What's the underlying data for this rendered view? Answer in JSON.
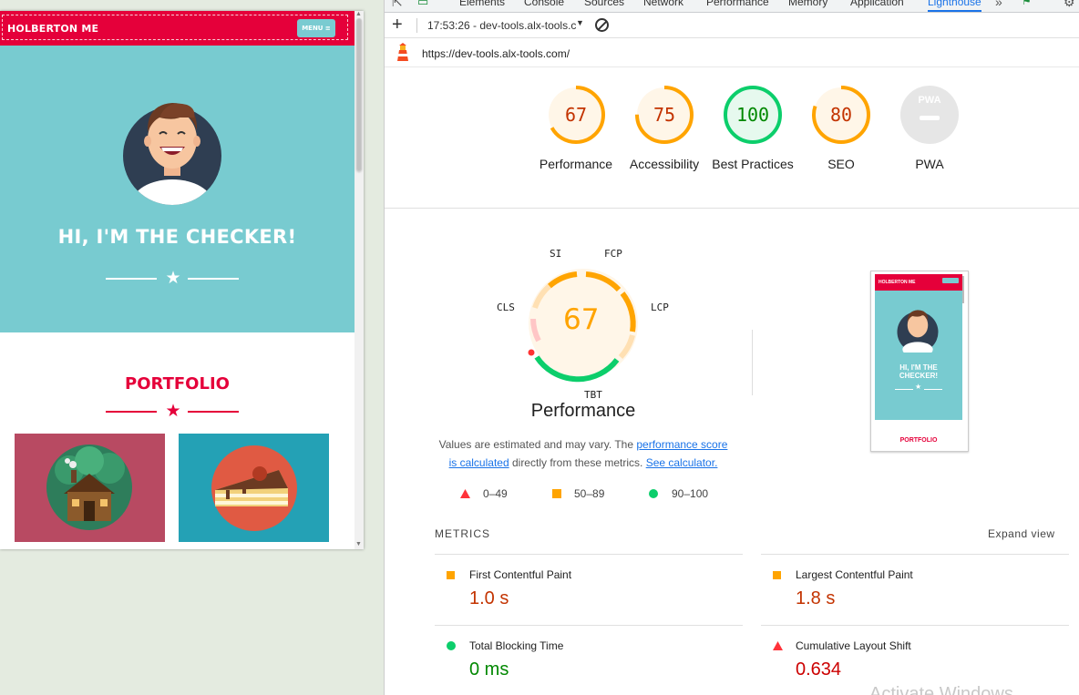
{
  "website": {
    "logo": "HOLBERTON ME",
    "menu_label": "MENU ≡",
    "hero_title": "HI, I'M THE CHECKER!",
    "portfolio_title": "PORTFOLIO"
  },
  "devtools": {
    "tabs": [
      "Elements",
      "Console",
      "Sources",
      "Network",
      "Performance",
      "Memory",
      "Application",
      "Lighthouse"
    ],
    "active_tab": "Lighthouse",
    "report_selector": "17:53:26 - dev-tools.alx-tools.c",
    "url": "https://dev-tools.alx-tools.com/"
  },
  "scores": [
    {
      "label": "Performance",
      "value": "67",
      "color": "#ffa400"
    },
    {
      "label": "Accessibility",
      "value": "75",
      "color": "#ffa400"
    },
    {
      "label": "Best Practices",
      "value": "100",
      "color": "#0cce6b"
    },
    {
      "label": "SEO",
      "value": "80",
      "color": "#ffa400"
    },
    {
      "label": "PWA",
      "value": "PWA",
      "color": "#9e9e9e"
    }
  ],
  "performance": {
    "score": "67",
    "title": "Performance",
    "metric_labels": {
      "si": "SI",
      "fcp": "FCP",
      "lcp": "LCP",
      "tbt": "TBT",
      "cls": "CLS"
    },
    "description_prefix": "Values are estimated and may vary. The ",
    "link_score_line1": "performance score",
    "link_score_line2": "is calculated",
    "description_mid": " directly from these metrics. ",
    "link_calculator": "See calculator.",
    "legend": [
      {
        "icon": "triangle-red",
        "label": "0–49"
      },
      {
        "icon": "square-orange",
        "label": "50–89"
      },
      {
        "icon": "circle-green",
        "label": "90–100"
      }
    ]
  },
  "thumbnail": {
    "logo": "HOLBERTON ME",
    "title_line1": "HI, I'M THE",
    "title_line2": "CHECKER!",
    "portfolio": "PORTFOLIO"
  },
  "metrics_section": {
    "heading": "METRICS",
    "expand": "Expand view",
    "items": [
      {
        "name": "First Contentful Paint",
        "value": "1.0 s",
        "status": "average",
        "color": "#c33300"
      },
      {
        "name": "Largest Contentful Paint",
        "value": "1.8 s",
        "status": "average",
        "color": "#c33300"
      },
      {
        "name": "Total Blocking Time",
        "value": "0 ms",
        "status": "pass",
        "color": "#008800"
      },
      {
        "name": "Cumulative Layout Shift",
        "value": "0.634",
        "status": "fail",
        "color": "#cc0000"
      }
    ]
  },
  "watermark": "Activate Windows",
  "colors": {
    "accent_red": "#e5003a",
    "hero_teal": "#78cbd0",
    "lh_orange": "#ffa400",
    "lh_green": "#0cce6b",
    "lh_red": "#ff4e42"
  }
}
